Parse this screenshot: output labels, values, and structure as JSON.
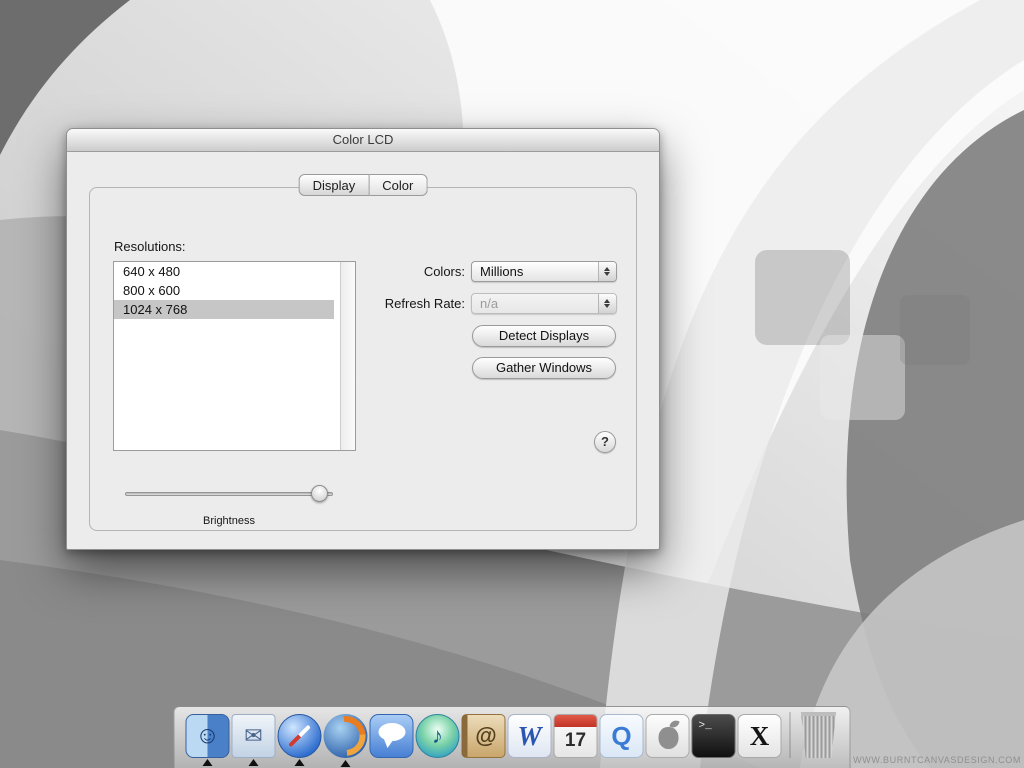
{
  "desktop": {
    "watermark": "WWW.BURNTCANVASDESIGN.COM"
  },
  "window": {
    "title": "Color LCD",
    "tabs": {
      "display": "Display",
      "color": "Color"
    },
    "resolutions_label": "Resolutions:",
    "resolutions": [
      {
        "label": "640 x 480"
      },
      {
        "label": "800 x 600"
      },
      {
        "label": "1024 x 768"
      }
    ],
    "colors_label": "Colors:",
    "colors_value": "Millions",
    "refresh_label": "Refresh Rate:",
    "refresh_value": "n/a",
    "detect_button": "Detect Displays",
    "gather_button": "Gather Windows",
    "help_label": "?",
    "brightness_label": "Brightness"
  },
  "dock": {
    "items": [
      {
        "name": "finder",
        "glyph": "☺",
        "running": true
      },
      {
        "name": "mail",
        "glyph": "✉",
        "running": true
      },
      {
        "name": "safari",
        "glyph": "",
        "running": true
      },
      {
        "name": "firefox",
        "glyph": "",
        "running": true
      },
      {
        "name": "ichat",
        "glyph": "",
        "running": false
      },
      {
        "name": "itunes",
        "glyph": "♪",
        "running": false
      },
      {
        "name": "address-book",
        "glyph": "@",
        "running": false
      },
      {
        "name": "word",
        "glyph": "W",
        "running": false
      },
      {
        "name": "ical",
        "glyph": "17",
        "running": false
      },
      {
        "name": "quicktime",
        "glyph": "Q",
        "running": false
      },
      {
        "name": "apple",
        "glyph": "",
        "running": false
      },
      {
        "name": "terminal",
        "glyph": ">_",
        "running": false
      },
      {
        "name": "x11",
        "glyph": "X",
        "running": false
      },
      {
        "name": "trash",
        "glyph": "",
        "running": false
      }
    ]
  }
}
